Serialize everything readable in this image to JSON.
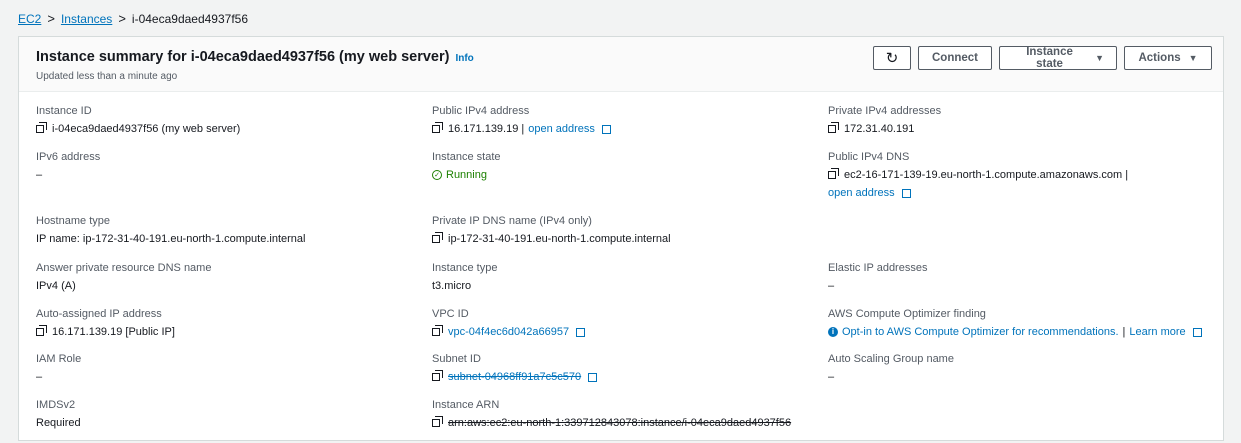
{
  "breadcrumb": {
    "items": [
      "EC2",
      "Instances"
    ],
    "separator": ">",
    "current": "i-04eca9daed4937f56"
  },
  "header": {
    "title": "Instance summary for i-04eca9daed4937f56 (my web server)",
    "info": "Info",
    "updated": "Updated less than a minute ago",
    "buttons": {
      "refresh": "↻",
      "connect": "Connect",
      "instance_state": "Instance state",
      "actions": "Actions",
      "caret": "▼"
    }
  },
  "fields": {
    "instance_id": {
      "label": "Instance ID",
      "value": "i-04eca9daed4937f56 (my web server)"
    },
    "public_ipv4": {
      "label": "Public IPv4 address",
      "value": "16.171.139.19 |",
      "link": "open address"
    },
    "private_ipv4": {
      "label": "Private IPv4 addresses",
      "value": "172.31.40.191"
    },
    "ipv6": {
      "label": "IPv6 address",
      "value": "–"
    },
    "instance_state": {
      "label": "Instance state",
      "value": "Running"
    },
    "public_dns": {
      "label": "Public IPv4 DNS",
      "value": "ec2-16-171-139-19.eu-north-1.compute.amazonaws.com |",
      "link": "open address"
    },
    "hostname_type": {
      "label": "Hostname type",
      "value": "IP name: ip-172-31-40-191.eu-north-1.compute.internal"
    },
    "private_dns": {
      "label": "Private IP DNS name (IPv4 only)",
      "value": "ip-172-31-40-191.eu-north-1.compute.internal"
    },
    "answer_dns": {
      "label": "Answer private resource DNS name",
      "value": "IPv4 (A)"
    },
    "instance_type": {
      "label": "Instance type",
      "value": "t3.micro"
    },
    "elastic_ip": {
      "label": "Elastic IP addresses",
      "value": "–"
    },
    "auto_ip": {
      "label": "Auto-assigned IP address",
      "value": "16.171.139.19 [Public IP]"
    },
    "vpc_id": {
      "label": "VPC ID",
      "value": "vpc-04f4ec6d042a66957"
    },
    "optimizer": {
      "label": "AWS Compute Optimizer finding",
      "value": "Opt-in to AWS Compute Optimizer for recommendations.",
      "sep": "|",
      "link": "Learn more"
    },
    "iam_role": {
      "label": "IAM Role",
      "value": "–"
    },
    "subnet_id": {
      "label": "Subnet ID",
      "value": "subnet-04968ff91a7c5c570"
    },
    "asg_name": {
      "label": "Auto Scaling Group name",
      "value": "–"
    },
    "imdsv2": {
      "label": "IMDSv2",
      "value": "Required"
    },
    "instance_arn": {
      "label": "Instance ARN",
      "value": "arn:aws:ec2:eu-north-1:339712843078:instance/i-04eca9daed4937f56"
    }
  },
  "colors": {
    "link": "#0073bb",
    "running": "#1d8102",
    "text": "#16191f",
    "label": "#545b64"
  }
}
